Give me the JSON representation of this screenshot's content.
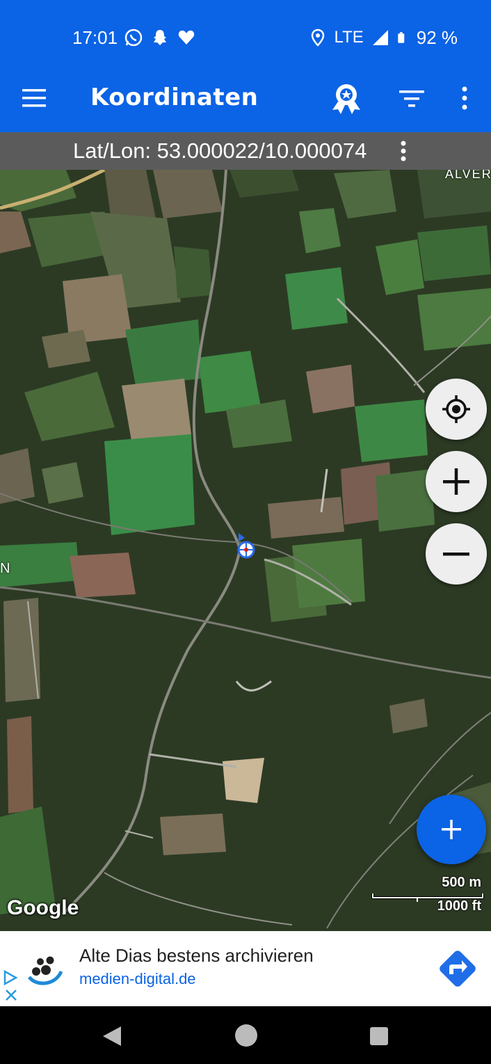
{
  "status_bar": {
    "time": "17:01",
    "left_icons": [
      "whatsapp-icon",
      "snapchat-icon",
      "heart-icon"
    ],
    "network": "LTE",
    "battery": "92 %",
    "right_icons": [
      "location-icon",
      "signal-icon",
      "battery-icon"
    ]
  },
  "app_bar": {
    "title": "Koordinaten",
    "icons": [
      "menu-icon",
      "badge-icon",
      "filter-icon",
      "more-vert-icon"
    ]
  },
  "coord_bar": {
    "text": "Lat/Lon: 53.000022/10.000074"
  },
  "map": {
    "place_label_top": "ALVER",
    "place_label_left": "N",
    "scale_metric": "500 m",
    "scale_imperial": "1000 ft",
    "attribution": "Google",
    "controls": [
      "my-location-icon",
      "zoom-in-icon",
      "zoom-out-icon",
      "add-icon"
    ],
    "colors": {
      "accent": "#0b63e5",
      "control_bg": "#eeeeee"
    }
  },
  "ad": {
    "title": "Alte Dias bestens archivieren",
    "url": "medien-digital.de"
  },
  "nav_bar": {
    "icons": [
      "back-icon",
      "home-icon",
      "recents-icon"
    ]
  }
}
